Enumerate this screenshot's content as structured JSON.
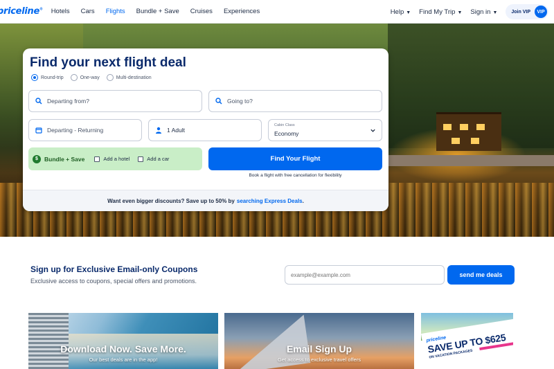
{
  "nav": {
    "logo": "priceline",
    "logo_mark": "®",
    "links": [
      "Hotels",
      "Cars",
      "Flights",
      "Bundle + Save",
      "Cruises",
      "Experiences"
    ],
    "active_link": "Flights",
    "right": {
      "help": "Help",
      "my_trip": "Find My Trip",
      "sign_in": "Sign in",
      "vip_label": "Join VIP",
      "vip_badge": "VIP"
    }
  },
  "search": {
    "title": "Find your next flight deal",
    "trip_types": [
      "Round-trip",
      "One-way",
      "Multi-destination"
    ],
    "selected_trip_type": "Round-trip",
    "from_placeholder": "Departing from?",
    "to_placeholder": "Going to?",
    "dates_placeholder": "Departing - Returning",
    "travelers": "1 Adult",
    "cabin_label": "Cabin Class",
    "cabin_value": "Economy",
    "bundle_title": "Bundle + Save",
    "add_hotel": "Add a hotel",
    "add_car": "Add a car",
    "find_button": "Find Your Flight",
    "flex_note": "Book a flight with free cancellation for flexibility",
    "footer_text": "Want even bigger discounts? Save up to 50% by",
    "footer_link": "searching Express Deals",
    "footer_end": "."
  },
  "signup": {
    "title": "Sign up for Exclusive Email-only Coupons",
    "subtitle": "Exclusive access to coupons, special offers and promotions.",
    "email_placeholder": "example@example.com",
    "button": "send me deals"
  },
  "promos": [
    {
      "title": "Download Now. Save More.",
      "subtitle": "Our best deals are in the app!"
    },
    {
      "title": "Email Sign Up",
      "subtitle": "Get access to exclusive travel offers"
    },
    {
      "logo": "priceline",
      "headline": "SAVE UP TO $625",
      "sub": "ON VACATION PACKAGES"
    }
  ],
  "colors": {
    "brand_blue": "#0068ef",
    "navy": "#0a2a6b",
    "bundle_green": "#c9eec7"
  }
}
